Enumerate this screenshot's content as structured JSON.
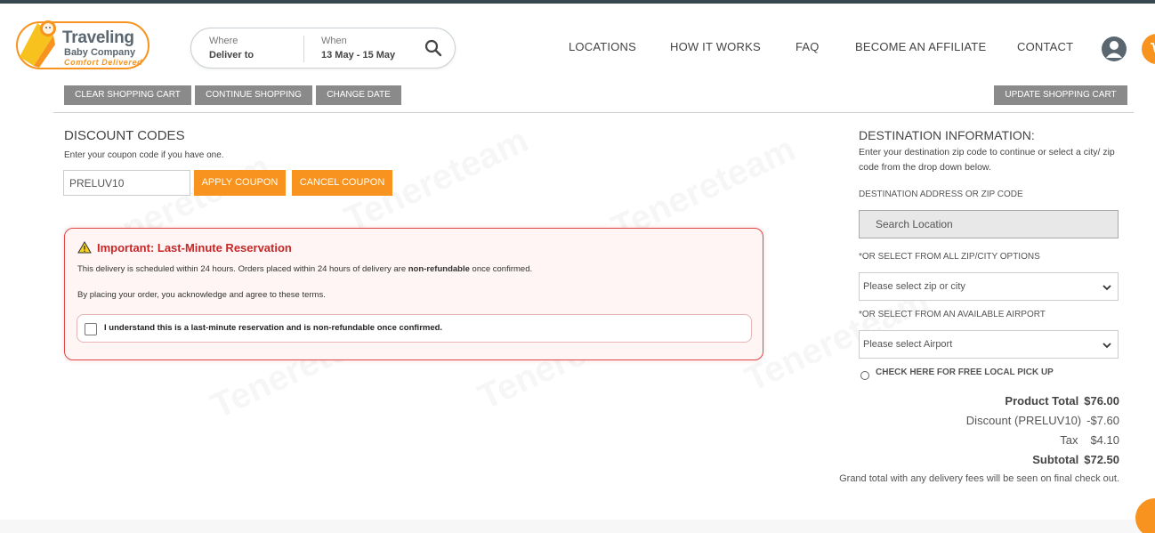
{
  "brand": {
    "name_line1": "Traveling",
    "name_line2": "Baby Company",
    "tagline": "Comfort Delivered",
    "accent_color": "#f7931e"
  },
  "search": {
    "where_label": "Where",
    "where_value": "Deliver to",
    "when_label": "When",
    "when_value": "13 May - 15 May"
  },
  "nav": {
    "items": [
      "LOCATIONS",
      "HOW IT WORKS",
      "FAQ",
      "BECOME AN AFFILIATE",
      "CONTACT"
    ]
  },
  "cart_actions": {
    "clear": "CLEAR SHOPPING CART",
    "continue": "CONTINUE SHOPPING",
    "change_date": "CHANGE DATE",
    "update": "UPDATE SHOPPING CART"
  },
  "discount": {
    "title": "DISCOUNT CODES",
    "help": "Enter your coupon code if you have one.",
    "code_value": "PRELUV10",
    "apply_label": "APPLY COUPON",
    "cancel_label": "CANCEL COUPON"
  },
  "alert": {
    "title": "Important: Last-Minute Reservation",
    "p1_before": "This delivery is scheduled within 24 hours. Orders placed within 24 hours of delivery are ",
    "p1_bold": "non-refundable",
    "p1_after": " once confirmed.",
    "p2": "By placing your order, you acknowledge and agree to these terms.",
    "ack_label": "I understand this is a last-minute reservation and is non-refundable once confirmed.",
    "ack_checked": false
  },
  "destination": {
    "title": "DESTINATION INFORMATION:",
    "help": "Enter your destination zip code to continue or select a city/ zip code from the drop down below.",
    "address_label": "DESTINATION ADDRESS OR ZIP CODE",
    "search_button": "Search Location",
    "zip_label": "*OR SELECT FROM ALL ZIP/CITY OPTIONS",
    "zip_placeholder": "Please select zip or city",
    "airport_label": "*OR SELECT FROM AN AVAILABLE AIRPORT",
    "airport_placeholder": "Please select Airport",
    "pickup_label": "CHECK HERE FOR FREE LOCAL PICK UP"
  },
  "totals": {
    "product_total_label": "Product Total",
    "product_total_value": "$76.00",
    "discount_label": "Discount (PRELUV10)",
    "discount_value": "-$7.60",
    "tax_label": "Tax",
    "tax_value": "$4.10",
    "subtotal_label": "Subtotal",
    "subtotal_value": "$72.50",
    "note": "Grand total with any delivery fees will be seen on final check out."
  },
  "watermark": "Tenereteam"
}
